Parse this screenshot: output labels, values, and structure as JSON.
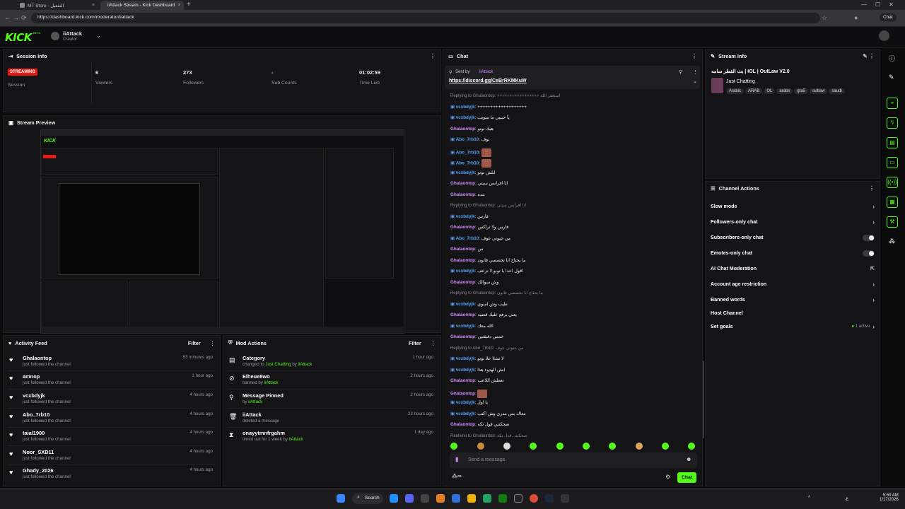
{
  "browser": {
    "tabs": [
      {
        "title": "MT Store - التفعيل"
      },
      {
        "title": "iiAttack Stream - Kick Dashboard"
      }
    ],
    "url": "https://dashboard.kick.com/moderator/iiattack",
    "chat_profile_label": "Chat"
  },
  "header": {
    "logo": "KICK",
    "beta": "BETA",
    "channel_name": "iiAttack",
    "role": "Creator"
  },
  "session": {
    "title": "Session Info",
    "status": "STREAMING",
    "status_label": "Session",
    "stats": [
      {
        "value": "6",
        "label": "Viewers"
      },
      {
        "value": "273",
        "label": "Followers"
      },
      {
        "value": "-",
        "label": "Sub Counts"
      },
      {
        "value": "01:02:59",
        "label": "Time Live"
      }
    ]
  },
  "preview": {
    "title": "Stream Preview"
  },
  "activity": {
    "title": "Activity Feed",
    "filter": "Filter",
    "items": [
      {
        "name": "Ghalaontop",
        "sub": "just followed the channel",
        "time": "53 minutes ago"
      },
      {
        "name": "amnop",
        "sub": "just followed the channel",
        "time": "1 hour ago"
      },
      {
        "name": "vcxbdyjk",
        "sub": "just followed the channel",
        "time": "4 hours ago"
      },
      {
        "name": "Abo_7rb10",
        "sub": "just followed the channel",
        "time": "4 hours ago"
      },
      {
        "name": "taial1900",
        "sub": "just followed the channel",
        "time": "4 hours ago"
      },
      {
        "name": "Noor_SXB11",
        "sub": "just followed the channel",
        "time": "4 hours ago"
      },
      {
        "name": "Ghady_2026",
        "sub": "just followed the channel",
        "time": "4 hours ago"
      }
    ]
  },
  "mod": {
    "title": "Mod Actions",
    "filter": "Filter",
    "items": [
      {
        "name": "Category",
        "sub1": "changed to ",
        "sub2": "Just Chatting",
        "sub3": " by ",
        "sub4": "iiAttack",
        "time": "1 hour ago"
      },
      {
        "name": "Elheue8wo",
        "sub1": "banned by ",
        "sub4": "iiAttack",
        "time": "2 hours ago"
      },
      {
        "name": "Message Pinned",
        "sub1": "by ",
        "sub4": "iiAttack",
        "time": "2 hours ago"
      },
      {
        "name": "iiAttack",
        "sub1": "deleted a message",
        "time": "23 hours ago"
      },
      {
        "name": "onayytmnfrgahm",
        "sub1": "timed out for 1 week by ",
        "sub4": "iiAttack",
        "time": "1 day ago"
      }
    ]
  },
  "chat": {
    "title": "Chat",
    "pinned_by": "Sent by",
    "pinned_user": "iiAttack",
    "pinned_link": "https://discord.gg/CeBrRKMKuW",
    "placeholder": "Send a message",
    "send": "Chat",
    "messages": [
      {
        "reply": "Replying to Ghalaontop: +++++++++++++++++ استغفر الله"
      },
      {
        "user": "vcxbdyjk",
        "color": "blue",
        "text": "+++++++++++++++++++"
      },
      {
        "user": "vcxbdyjk",
        "color": "blue",
        "text": "يا حبيبي ما سويت"
      },
      {
        "user": "Ghalaontop",
        "color": "pink",
        "text": "هيك تونو"
      },
      {
        "user": "Abo_7rb10",
        "color": "blue",
        "text": "توف"
      },
      {
        "user": "Abo_7rb10",
        "color": "blue",
        "text": ""
      },
      {
        "user": "Abo_7rb10",
        "color": "blue",
        "text": ""
      },
      {
        "user": "vcxbdyjk",
        "color": "blue",
        "text": "ابلش تونو"
      },
      {
        "user": "Ghalaontop",
        "color": "pink",
        "text": "انا افرانس سيتي"
      },
      {
        "user": "Ghalaontop",
        "color": "pink",
        "text": "بنده"
      },
      {
        "reply": "Replying to Ghalaontop: انا افرانس سيتي"
      },
      {
        "user": "vcxbdyjk",
        "color": "blue",
        "text": "فارس"
      },
      {
        "user": "Ghalaontop",
        "color": "pink",
        "text": "فارس ولا ثراكس"
      },
      {
        "user": "Abo_7rb10",
        "color": "blue",
        "text": "من جيوني عوف"
      },
      {
        "user": "Ghalaontop",
        "color": "pink",
        "text": "س"
      },
      {
        "user": "Ghalaontop",
        "color": "pink",
        "text": "ما يحتاج انا تخصصي قانون"
      },
      {
        "user": "vcxbdyjk",
        "color": "blue",
        "text": "اقول اعدا يا تونو لا تزعف"
      },
      {
        "user": "Ghalaontop",
        "color": "pink",
        "text": "وش سوالك"
      },
      {
        "reply": "Replying to Ghalaontop: ما يحتاج انا تخصصي قانون"
      },
      {
        "user": "vcxbdyjk",
        "color": "blue",
        "text": "طيب وش اسوي"
      },
      {
        "user": "Ghalaontop",
        "color": "pink",
        "text": "يعني برفع عليك قضيه"
      },
      {
        "user": "vcxbdyjk",
        "color": "blue",
        "text": "الله معك"
      },
      {
        "user": "Ghalaontop",
        "color": "pink",
        "text": "خمس دقيقتين"
      },
      {
        "reply": "Replying to Abo_7rb10: من جيوني عوف"
      },
      {
        "user": "vcxbdyjk",
        "color": "blue",
        "text": "لا تشلا علا تونو"
      },
      {
        "user": "vcxbdyjk",
        "color": "blue",
        "text": "ابش الهدوء هذا"
      },
      {
        "user": "Ghalaontop",
        "color": "pink",
        "text": "تعطش اللاعب"
      },
      {
        "user": "Ghalaontop",
        "color": "pink",
        "text": ""
      },
      {
        "user": "vcxbdyjk",
        "color": "blue",
        "text": "يا اول"
      },
      {
        "user": "vcxbdyjk",
        "color": "blue",
        "text": "معاك بس مدري وش اكتب"
      },
      {
        "user": "Ghalaontop",
        "color": "pink",
        "text": "ضحكتني قول تكه"
      },
      {
        "reply": "Replying to Ghalaontop: ضحكتني قول تكه"
      },
      {
        "user": "vcxbdyjk",
        "color": "blue",
        "text": "مهرج عندك انا"
      },
      {
        "user": "vcxbdyjk",
        "color": "blue",
        "text": "يله بس"
      }
    ]
  },
  "stream_info": {
    "title": "Stream Info",
    "stream_title": "بث القطر سامه | IOL | OutLaw V2.0",
    "category": "Just Chatting",
    "tags": [
      "Arabic",
      "ARAB",
      "OL",
      "arabs",
      "gta5",
      "outlaw",
      "saudi"
    ]
  },
  "channel_actions": {
    "title": "Channel Actions",
    "items": [
      {
        "label": "Slow mode",
        "kind": "arrow"
      },
      {
        "label": "Followers-only chat",
        "kind": "arrow"
      },
      {
        "label": "Subscribers-only chat",
        "kind": "toggle"
      },
      {
        "label": "Emotes-only chat",
        "kind": "toggle"
      },
      {
        "label": "AI Chat Moderation",
        "kind": "ext"
      },
      {
        "label": "Account age restriction",
        "kind": "arrow"
      },
      {
        "label": "Banned words",
        "kind": "arrow"
      },
      {
        "label": "Host Channel",
        "kind": "none"
      },
      {
        "label": "Set goals",
        "kind": "goals",
        "extra": "1 active"
      }
    ]
  },
  "taskbar": {
    "search": "Search",
    "time": "5:50 AM",
    "date": "1/17/2026",
    "lang": "ع"
  }
}
